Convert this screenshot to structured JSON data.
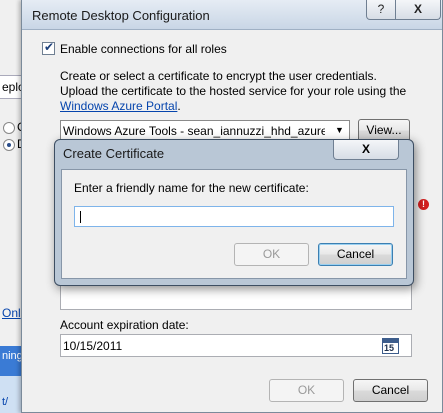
{
  "background": {
    "tab_label": "eploy",
    "radio_1_label": "C",
    "radio_2_label": "D",
    "link_text": "Onl",
    "output_strip": "ning",
    "output_text": "t/"
  },
  "dialog": {
    "title": "Remote Desktop Configuration",
    "help_glyph": "?",
    "close_glyph": "X",
    "enable_label": "Enable connections for all roles",
    "enable_checked": true,
    "description_line1": "Create or select a certificate to encrypt the user credentials.",
    "description_line2": "Upload the certificate to the hosted service for your role using the",
    "portal_link": "Windows Azure Portal",
    "portal_link_suffix": ".",
    "certificate_value": "Windows Azure Tools - sean_iannuzzi_hhd_azure_",
    "view_button": "View...",
    "expiration_label": "Account expiration date:",
    "expiration_value": "10/15/2011",
    "calendar_day": "15",
    "ok_button": "OK",
    "cancel_button": "Cancel",
    "error_glyph": "!"
  },
  "child_dialog": {
    "title": "Create Certificate",
    "close_glyph": "X",
    "prompt": "Enter a friendly name for the new certificate:",
    "name_value": "",
    "ok_button": "OK",
    "cancel_button": "Cancel"
  },
  "colors": {
    "link": "#0645ad",
    "error": "#d21f1f",
    "default_button_border": "#3c7fb1"
  }
}
